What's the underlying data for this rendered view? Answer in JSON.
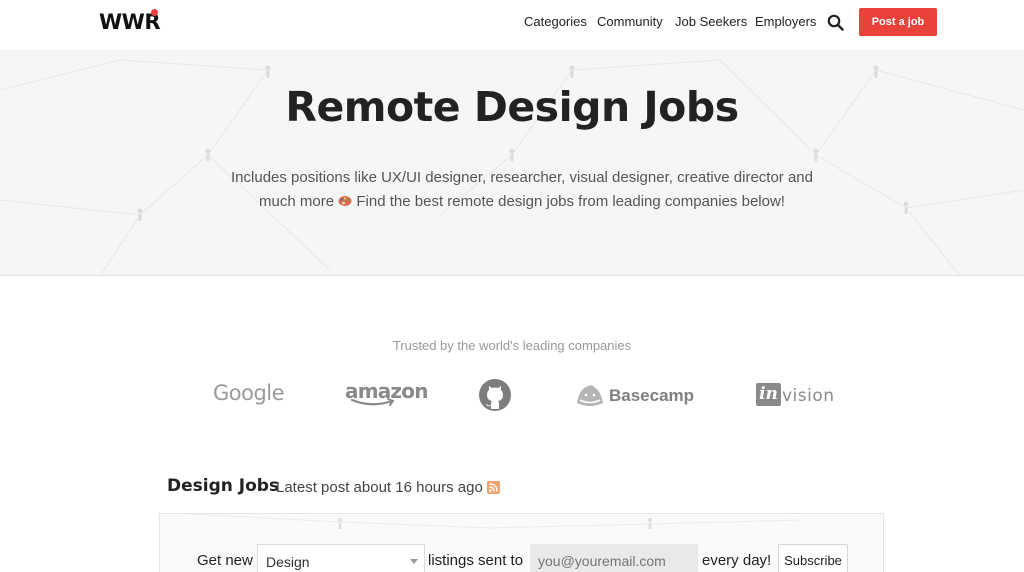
{
  "header": {
    "logo": "WWR",
    "nav": {
      "categories": "Categories",
      "community": "Community",
      "job_seekers": "Job Seekers",
      "employers": "Employers"
    },
    "post_job_label": "Post a job",
    "accent_color": "#e8423a"
  },
  "hero": {
    "title": "Remote Design Jobs",
    "subtitle_before_emoji": "Includes positions like UX/UI designer, researcher, visual designer, creative director and much more",
    "subtitle_after_emoji": "Find the best remote design jobs from leading companies below!",
    "emoji": "artist-palette-icon"
  },
  "trusted": {
    "label": "Trusted by the world's leading companies",
    "companies": {
      "google": "Google",
      "amazon": "amazon",
      "github": "github-icon",
      "basecamp": "Basecamp",
      "invision_box": "in",
      "invision": "vision"
    }
  },
  "jobs": {
    "title": "Design Jobs",
    "latest": "Latest post about 16 hours ago",
    "rss": "rss-icon"
  },
  "subscribe": {
    "get_new": "Get new",
    "category_selected": "Design",
    "listings_sent_to": "listings sent to",
    "email_placeholder": "you@youremail.com",
    "every_day": "every day!",
    "button": "Subscribe"
  }
}
